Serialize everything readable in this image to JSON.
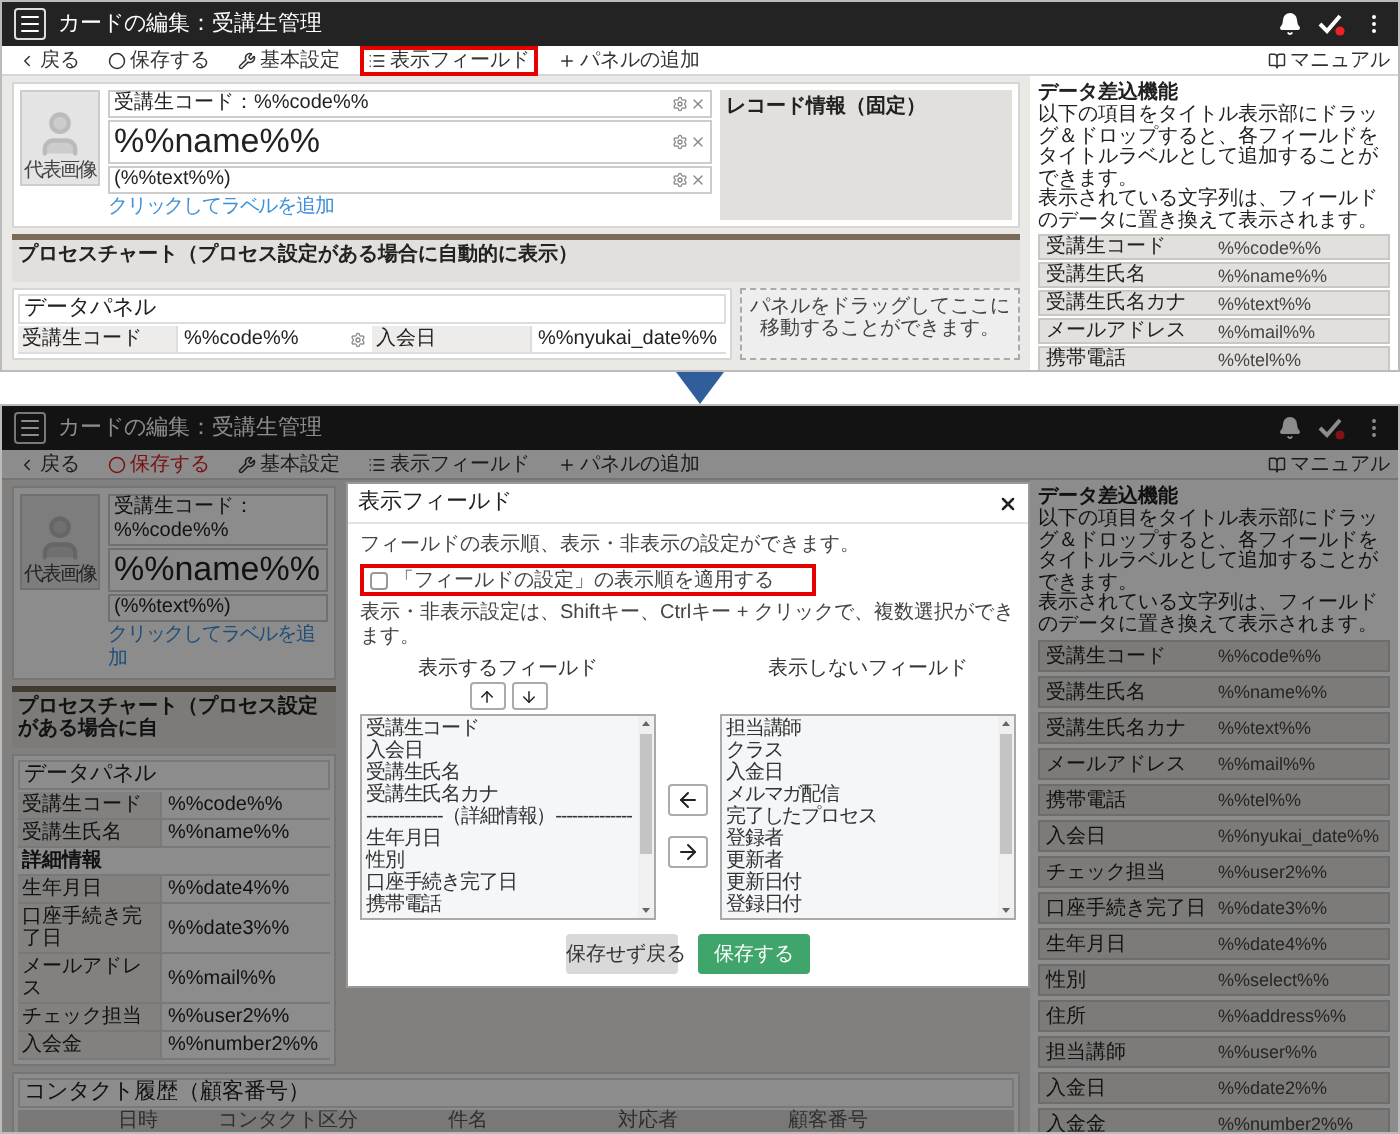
{
  "top_screen": {
    "header": {
      "title": "カードの編集：受講生管理"
    },
    "toolbar": {
      "items": [
        {
          "kind": "back",
          "label": "戻る",
          "alert": false,
          "highlighted": false
        },
        {
          "kind": "save",
          "label": "保存する",
          "alert": false,
          "highlighted": false
        },
        {
          "kind": "settings",
          "label": "基本設定",
          "alert": false,
          "highlighted": false
        },
        {
          "kind": "fields",
          "label": "表示フィールド",
          "alert": false,
          "highlighted": true
        },
        {
          "kind": "add",
          "label": "パネルの追加",
          "alert": false,
          "highlighted": false
        }
      ],
      "manual": "マニュアル"
    },
    "card": {
      "photo_label": "代表画像",
      "code_label": "受講生コード：%%code%%",
      "name": "%%name%%",
      "subtext": "(%%text%%)",
      "add_label_link": "クリックしてラベルを追加",
      "record_info": "レコード情報（固定）"
    },
    "process_chart": {
      "title": "プロセスチャート（プロセス設定がある場合に自動的に表示）"
    },
    "data_panel": {
      "title": "データパネル",
      "rows": [
        {
          "kind": "field_pair",
          "label": "受講生コード",
          "value": "%%code%%",
          "label_2": "入会日",
          "value_2": "%%nyukai_date%%"
        }
      ]
    },
    "drop_hint": "パネルをドラッグしてここに移動することができます。",
    "side_panel": {
      "title": "データ差込機能",
      "description": [
        "以下の項目をタイトル表示部にドラッグ＆ドロップすると、各フィールドをタイトルラベルとして追加することができます。",
        "表示されている文字列は、フィールドのデータに置き換えて表示されます。"
      ],
      "fields": [
        {
          "label": "受講生コード",
          "token": "%%code%%"
        },
        {
          "label": "受講生氏名",
          "token": "%%name%%"
        },
        {
          "label": "受講生氏名カナ",
          "token": "%%text%%"
        },
        {
          "label": "メールアドレス",
          "token": "%%mail%%"
        },
        {
          "label": "携帯電話",
          "token": "%%tel%%"
        }
      ]
    }
  },
  "bottom_screen": {
    "header": {
      "title": "カードの編集：受講生管理"
    },
    "toolbar": {
      "items": [
        {
          "kind": "back",
          "label": "戻る",
          "alert": false,
          "highlighted": false
        },
        {
          "kind": "save",
          "label": "保存する",
          "alert": true,
          "highlighted": false
        },
        {
          "kind": "settings",
          "label": "基本設定",
          "alert": false,
          "highlighted": false
        },
        {
          "kind": "fields",
          "label": "表示フィールド",
          "alert": false,
          "highlighted": false
        },
        {
          "kind": "add",
          "label": "パネルの追加",
          "alert": false,
          "highlighted": false
        }
      ],
      "manual": "マニュアル"
    },
    "card": {
      "photo_label": "代表画像",
      "code_label": "受講生コード：%%code%%",
      "name": "%%name%%",
      "subtext": "(%%text%%)",
      "add_label_link": "クリックしてラベルを追加"
    },
    "process_chart": {
      "title": "プロセスチャート（プロセス設定がある場合に自"
    },
    "data_panel": {
      "title": "データパネル",
      "rows": [
        {
          "kind": "field",
          "label": "受講生コード",
          "value": "%%code%%"
        },
        {
          "kind": "field",
          "label": "受講生氏名",
          "value": "%%name%%"
        },
        {
          "kind": "heading",
          "label": "詳細情報"
        },
        {
          "kind": "field",
          "label": "生年月日",
          "value": "%%date4%%"
        },
        {
          "kind": "field",
          "label": "口座手続き完了日",
          "value": "%%date3%%"
        },
        {
          "kind": "field",
          "label": "メールアドレス",
          "value": "%%mail%%"
        },
        {
          "kind": "field",
          "label": "チェック担当",
          "value": "%%user2%%"
        },
        {
          "kind": "field",
          "label": "入会金",
          "value": "%%number2%%"
        }
      ]
    },
    "contact_history": {
      "title": "コンタクト履歴（顧客番号）",
      "columns": [
        "日時",
        "コンタクト区分",
        "件名",
        "対応者",
        "顧客番号"
      ]
    },
    "side_panel": {
      "title": "データ差込機能",
      "description": [
        "以下の項目をタイトル表示部にドラッグ＆ドロップすると、各フィールドをタイトルラベルとして追加することができます。",
        "表示されている文字列は、フィールドのデータに置き換えて表示されます。"
      ],
      "fields": [
        {
          "label": "受講生コード",
          "token": "%%code%%"
        },
        {
          "label": "受講生氏名",
          "token": "%%name%%"
        },
        {
          "label": "受講生氏名カナ",
          "token": "%%text%%"
        },
        {
          "label": "メールアドレス",
          "token": "%%mail%%"
        },
        {
          "label": "携帯電話",
          "token": "%%tel%%"
        },
        {
          "label": "入会日",
          "token": "%%nyukai_date%%"
        },
        {
          "label": "チェック担当",
          "token": "%%user2%%"
        },
        {
          "label": "口座手続き完了日",
          "token": "%%date3%%"
        },
        {
          "label": "生年月日",
          "token": "%%date4%%"
        },
        {
          "label": "性別",
          "token": "%%select%%"
        },
        {
          "label": "住所",
          "token": "%%address%%"
        },
        {
          "label": "担当講師",
          "token": "%%user%%"
        },
        {
          "label": "入金日",
          "token": "%%date2%%"
        },
        {
          "label": "入金金",
          "token": "%%number2%%"
        }
      ]
    },
    "modal": {
      "title": "表示フィールド",
      "description": "フィールドの表示順、表示・非表示の設定ができます。",
      "checkbox_row": {
        "label": "「フィールドの設定」の表示順を適用する",
        "checked": false,
        "highlighted": true
      },
      "instruction": "表示・非表示設定は、Shiftキー、Ctrlキー + クリックで、複数選択ができます。",
      "shown_fields": {
        "title": "表示するフィールド",
        "items": [
          {
            "label": "受講生コード",
            "selected": false
          },
          {
            "label": "入会日",
            "selected": false
          },
          {
            "label": "受講生氏名",
            "selected": false
          },
          {
            "label": "受講生氏名カナ",
            "selected": false
          },
          {
            "label": "--------------（詳細情報）--------------",
            "selected": false
          },
          {
            "label": "生年月日",
            "selected": false
          },
          {
            "label": "性別",
            "selected": false
          },
          {
            "label": "口座手続き完了日",
            "selected": false
          },
          {
            "label": "携帯電話",
            "selected": false
          }
        ]
      },
      "hidden_fields": {
        "title": "表示しないフィールド",
        "items": [
          {
            "label": "担当講師",
            "selected": false
          },
          {
            "label": "クラス",
            "selected": false
          },
          {
            "label": "入金日",
            "selected": false
          },
          {
            "label": "メルマガ配信",
            "selected": false
          },
          {
            "label": "完了したプロセス",
            "selected": false
          },
          {
            "label": "登録者",
            "selected": false
          },
          {
            "label": "更新者",
            "selected": false
          },
          {
            "label": "更新日付",
            "selected": false
          },
          {
            "label": "登録日付",
            "selected": false
          }
        ]
      },
      "buttons": [
        {
          "kind": "cancel",
          "label": "保存せず戻る"
        },
        {
          "kind": "save",
          "label": "保存する"
        }
      ]
    }
  }
}
